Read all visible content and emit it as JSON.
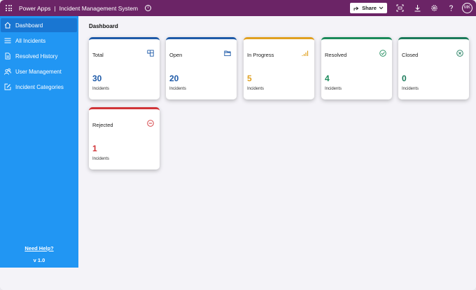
{
  "topbar": {
    "app_name": "Power Apps",
    "separator": "|",
    "app_title": "Incident Management System",
    "share_label": "Share",
    "avatar_initials": "MK",
    "bg_color": "#6b2466"
  },
  "sidebar": {
    "items": [
      {
        "label": "Dashboard",
        "icon": "home-icon",
        "active": true
      },
      {
        "label": "All Incidents",
        "icon": "list-icon",
        "active": false
      },
      {
        "label": "Resolved History",
        "icon": "document-icon",
        "active": false
      },
      {
        "label": "User Management",
        "icon": "users-icon",
        "active": false
      },
      {
        "label": "Incident Categories",
        "icon": "edit-box-icon",
        "active": false
      }
    ],
    "help_link": "Need Help?",
    "version": "v 1.0",
    "bg_color": "#2196f3"
  },
  "main": {
    "title": "Dashboard",
    "cards": [
      {
        "title": "Total",
        "value": "30",
        "sub": "Incidents",
        "icon": "grid-icon",
        "color": "#1e5aa8"
      },
      {
        "title": "Open",
        "value": "20",
        "sub": "Incidents",
        "icon": "folder-icon",
        "color": "#1e5aa8"
      },
      {
        "title": "In Progress",
        "value": "5",
        "sub": "Incidents",
        "icon": "signal-bars-icon",
        "color": "#e0a020"
      },
      {
        "title": "Resolved",
        "value": "4",
        "sub": "Incidents",
        "icon": "check-circle-icon",
        "color": "#1a8a5a"
      },
      {
        "title": "Closed",
        "value": "0",
        "sub": "Incidents",
        "icon": "x-circle-icon",
        "color": "#1a7a5a"
      },
      {
        "title": "Rejected",
        "value": "1",
        "sub": "Incidents",
        "icon": "minus-circle-icon",
        "color": "#d13438"
      }
    ]
  }
}
